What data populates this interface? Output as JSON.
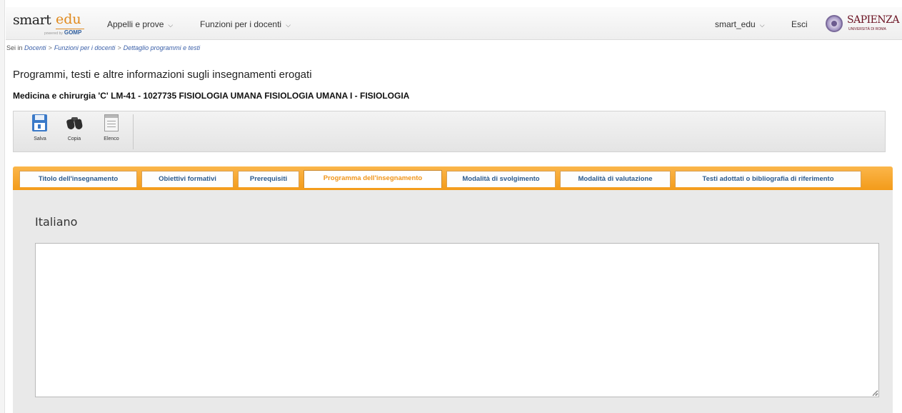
{
  "header": {
    "logo_smart": "smart",
    "logo_edu": "edu",
    "logo_gomp": "GOMP",
    "logo_gomp_prefix": "powered by",
    "menus": [
      {
        "label": "Appelli e prove"
      },
      {
        "label": "Funzioni per i docenti"
      }
    ],
    "user_menu": "smart_edu",
    "logout": "Esci",
    "brand": "SAPIENZA",
    "brand_sub": "UNIVERSITÀ DI ROMA"
  },
  "breadcrumb": {
    "lead": "Sei in",
    "items": [
      "Docenti",
      "Funzioni per i docenti",
      "Dettaglio programmi e testi"
    ],
    "separator": ">"
  },
  "page": {
    "title": "Programmi, testi e altre informazioni sugli insegnamenti erogati",
    "course": "Medicina e chirurgia 'C' LM-41 - 1027735 FISIOLOGIA UMANA FISIOLOGIA UMANA I - FISIOLOGIA"
  },
  "toolbar": {
    "save_label": "Salva",
    "copy_label": "Copia",
    "list_label": "Elenco"
  },
  "tabs": [
    {
      "label": "Titolo dell'insegnamento",
      "active": false
    },
    {
      "label": "Obiettivi formativi",
      "active": false
    },
    {
      "label": "Prerequisiti",
      "active": false
    },
    {
      "label": "Programma dell'insegnamento",
      "active": true
    },
    {
      "label": "Modalità di svolgimento",
      "active": false
    },
    {
      "label": "Modalità di valutazione",
      "active": false
    },
    {
      "label": "Testi adottati o bibliografia di riferimento",
      "active": false
    }
  ],
  "content": {
    "language_label": "Italiano",
    "editor_value": ""
  },
  "colors": {
    "tab_bar": "#f39b1a",
    "tab_text": "#2a5a8e",
    "tab_active_text": "#f09418",
    "content_bg": "#e9e9e9"
  }
}
